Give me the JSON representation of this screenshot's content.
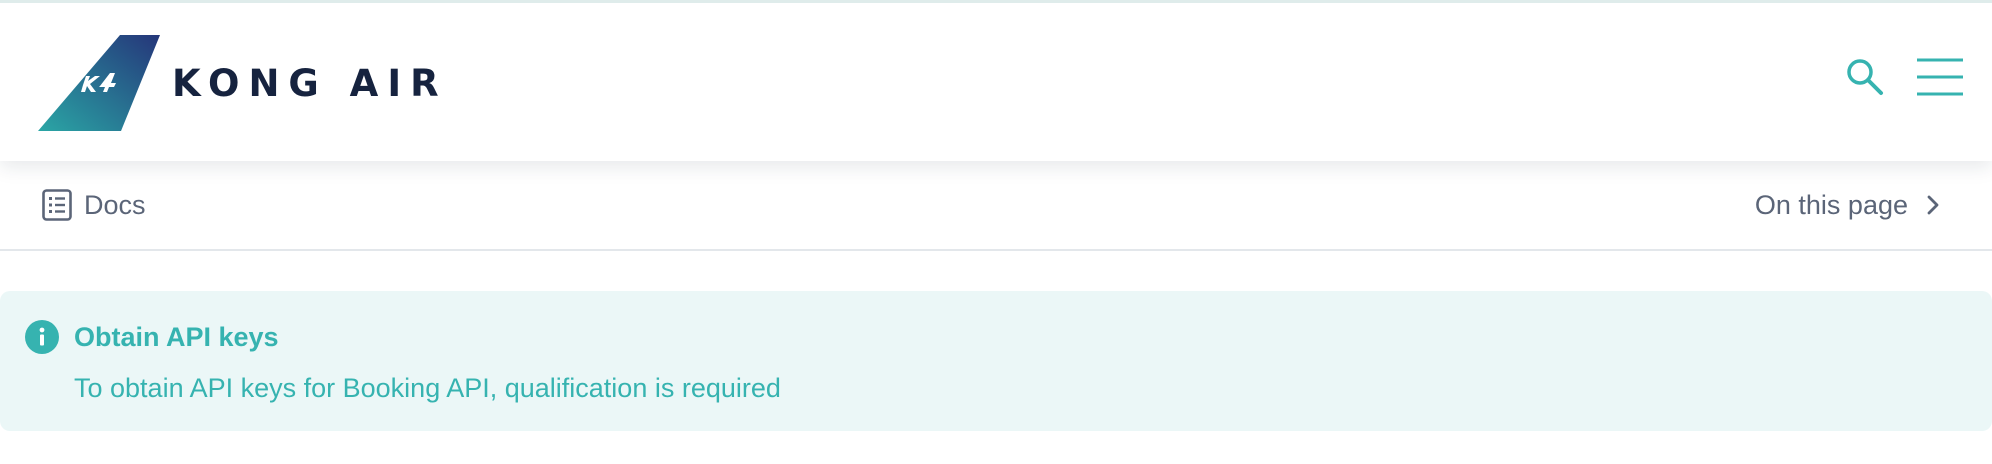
{
  "header": {
    "brand_name": "KONG AIR",
    "logo_monogram": "K4",
    "icons": {
      "search": "search-icon",
      "menu": "hamburger-menu-icon"
    }
  },
  "subnav": {
    "docs_label": "Docs",
    "on_this_page_label": "On this page",
    "icons": {
      "docs": "document-list-icon",
      "chevron": "chevron-right-icon"
    }
  },
  "callout": {
    "title": "Obtain API keys",
    "body": "To obtain API keys for Booking API, qualification is required",
    "icon": "info-icon"
  },
  "colors": {
    "accent": "#36b3b0",
    "callout_background": "#ebf7f7",
    "brand_text": "#16233f",
    "muted_text": "#5b6578",
    "logo_gradient_start": "#2a9fa6",
    "logo_gradient_end": "#243a78"
  }
}
